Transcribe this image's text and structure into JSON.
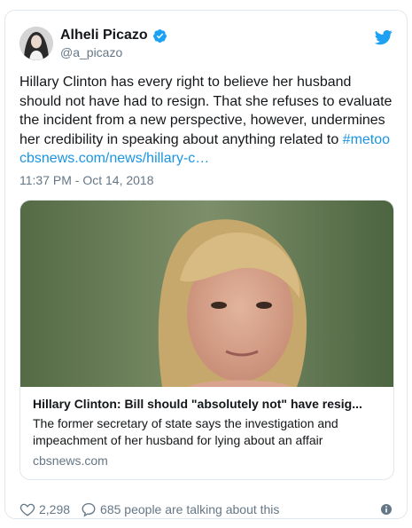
{
  "author": {
    "name": "Alheli Picazo",
    "handle": "@a_picazo"
  },
  "tweet": {
    "text": "Hillary Clinton has every right to believe her husband should not have had to resign. That she refuses to evaluate the incident from a new perspective, however, undermines her credibility in speaking about anything related to ",
    "hashtag": "#metoo",
    "link": "cbsnews.com/news/hillary-c…",
    "timestamp": "11:37 PM - Oct 14, 2018"
  },
  "card": {
    "title": "Hillary Clinton: Bill should \"absolutely not\" have resig...",
    "description": "The former secretary of state says the investigation and impeachment of her husband for lying about an affair",
    "domain": "cbsnews.com"
  },
  "footer": {
    "likes": "2,298",
    "talking": "685 people are talking about this"
  },
  "colors": {
    "link": "#1b95e0",
    "secondary_text": "#657786",
    "twitter_blue": "#1da1f2"
  },
  "icons": [
    "verified-badge-icon",
    "twitter-bird-icon",
    "heart-icon",
    "comment-icon",
    "info-icon"
  ]
}
